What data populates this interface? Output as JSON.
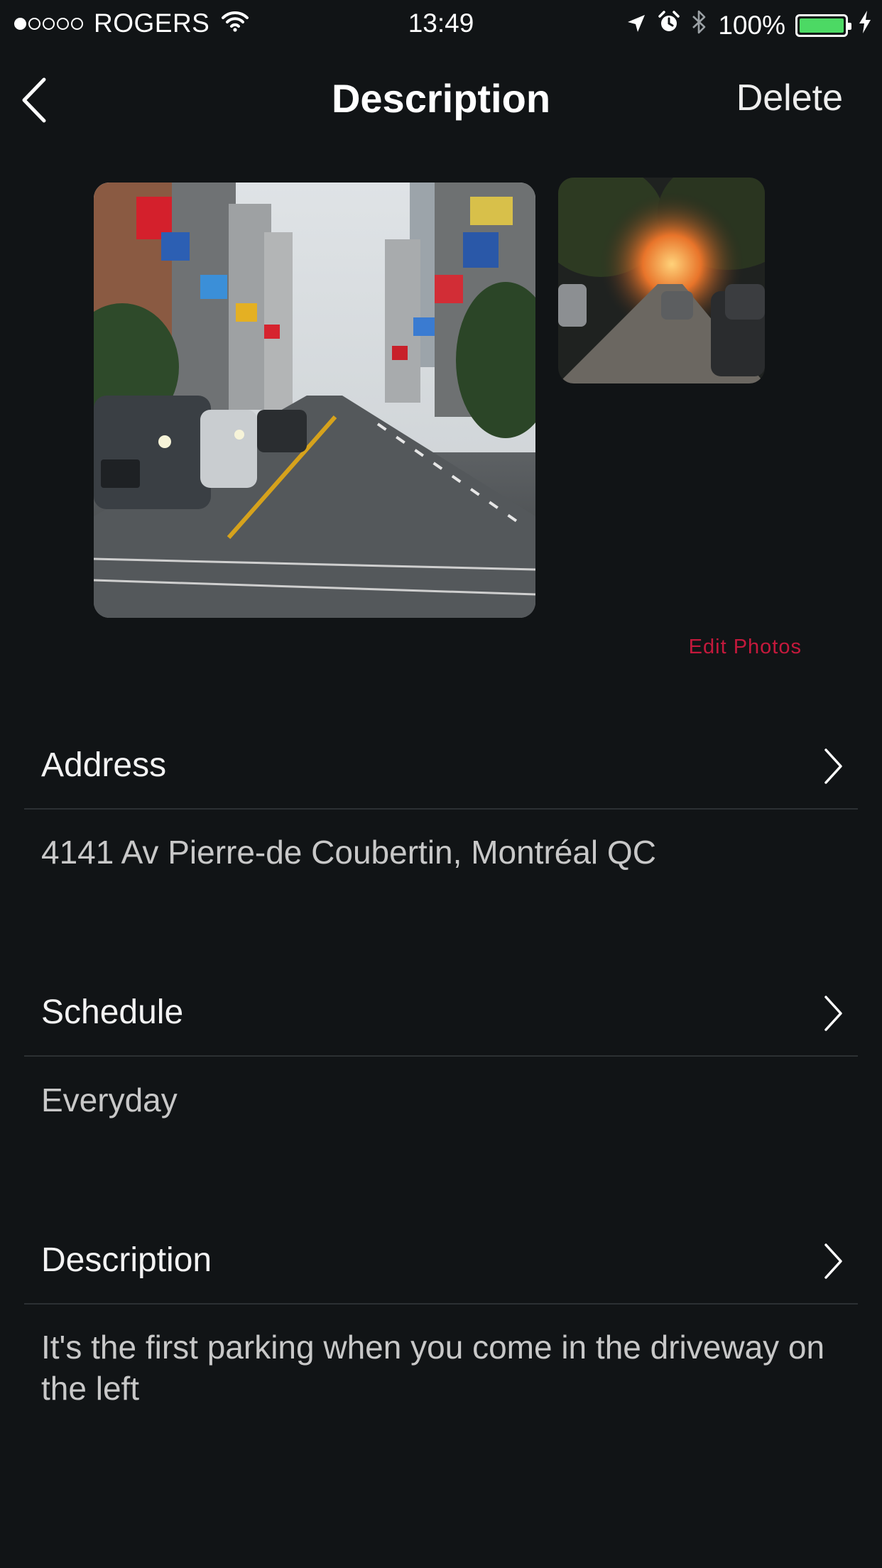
{
  "status_bar": {
    "carrier": "ROGERS",
    "time": "13:49",
    "battery_percent": "100%",
    "signal_bars_filled": 1,
    "signal_bars_total": 5,
    "battery_level": 1.0,
    "battery_color": "#4cd964"
  },
  "nav": {
    "title": "Description",
    "delete_label": "Delete",
    "back_icon": "chevron-left-icon"
  },
  "photos": {
    "edit_label": "Edit Photos",
    "accent_color": "#c4193c"
  },
  "sections": {
    "address": {
      "label": "Address",
      "value": "4141 Av Pierre-de Coubertin, Montréal QC"
    },
    "schedule": {
      "label": "Schedule",
      "value": "Everyday"
    },
    "description": {
      "label": "Description",
      "value": "It's the first parking when you come in the driveway on the left"
    }
  }
}
